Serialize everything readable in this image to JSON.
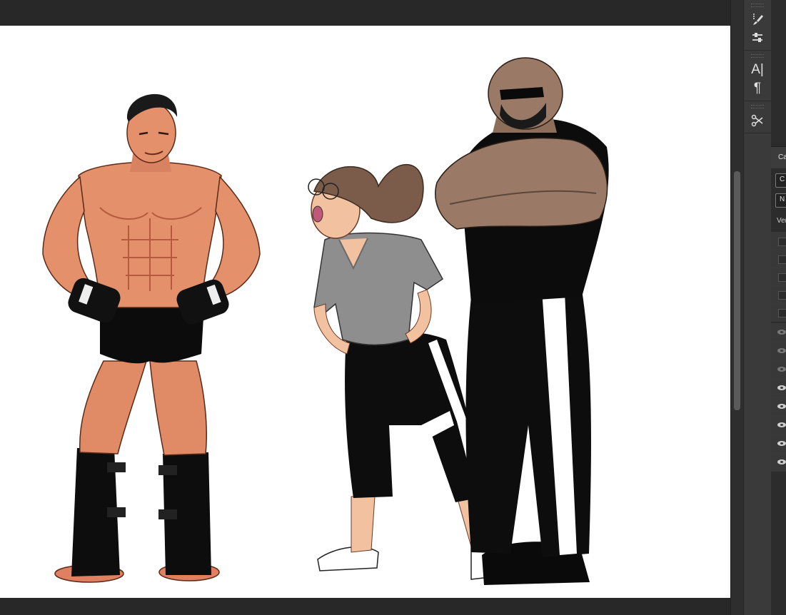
{
  "canvas": {
    "background": "#ffffff",
    "artwork": "three-character-illustration"
  },
  "tools": [
    {
      "name": "brush-icon"
    },
    {
      "name": "adjust-icon"
    },
    {
      "name": "type-icon",
      "glyph": "A|"
    },
    {
      "name": "paragraph-icon",
      "glyph": "¶"
    },
    {
      "name": "scissors-icon"
    }
  ],
  "panel": {
    "tab": "Ca",
    "box1": "C",
    "box2": "N",
    "label": "Ver"
  }
}
